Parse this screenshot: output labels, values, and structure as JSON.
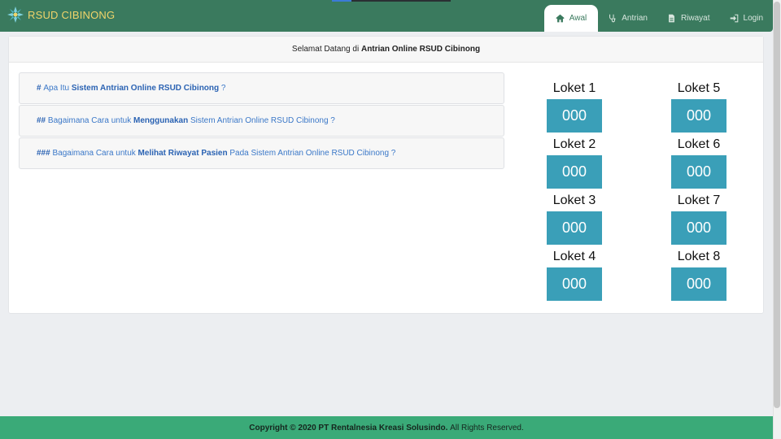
{
  "header": {
    "brand": "RSUD CIBINONG",
    "nav": [
      {
        "label": "Awal",
        "icon": "home-icon",
        "active": true
      },
      {
        "label": "Antrian",
        "icon": "stethoscope-icon",
        "active": false
      },
      {
        "label": "Riwayat",
        "icon": "document-icon",
        "active": false
      },
      {
        "label": "Login",
        "icon": "sign-in-icon",
        "active": false
      }
    ]
  },
  "welcome": {
    "prefix": "Selamat Datang di",
    "highlight": "Antrian Online RSUD Cibinong"
  },
  "faq": [
    {
      "marker": "#",
      "pre": "Apa Itu",
      "bold": "Sistem Antrian Online RSUD Cibinong",
      "post": "?"
    },
    {
      "marker": "##",
      "pre": "Bagaimana Cara untuk",
      "bold": "Menggunakan",
      "post": "Sistem Antrian Online RSUD Cibinong ?"
    },
    {
      "marker": "###",
      "pre": "Bagaimana Cara untuk",
      "bold": "Melihat Riwayat Pasien",
      "post": "Pada Sistem Antrian Online RSUD Cibinong ?"
    }
  ],
  "lokets": [
    {
      "title": "Loket 1",
      "number": "000"
    },
    {
      "title": "Loket 2",
      "number": "000"
    },
    {
      "title": "Loket 3",
      "number": "000"
    },
    {
      "title": "Loket 4",
      "number": "000"
    },
    {
      "title": "Loket 5",
      "number": "000"
    },
    {
      "title": "Loket 6",
      "number": "000"
    },
    {
      "title": "Loket 7",
      "number": "000"
    },
    {
      "title": "Loket 8",
      "number": "000"
    }
  ],
  "footer": {
    "copyright": "Copyright © 2020 PT Rentalnesia Kreasi Solusindo.",
    "rights": "All Rights Reserved."
  },
  "colors": {
    "navbar": "#3a7a5e",
    "brand_text": "#f0d46a",
    "loket_box": "#3a9fb8",
    "footer": "#3aaa78",
    "link": "#3b78c8"
  }
}
